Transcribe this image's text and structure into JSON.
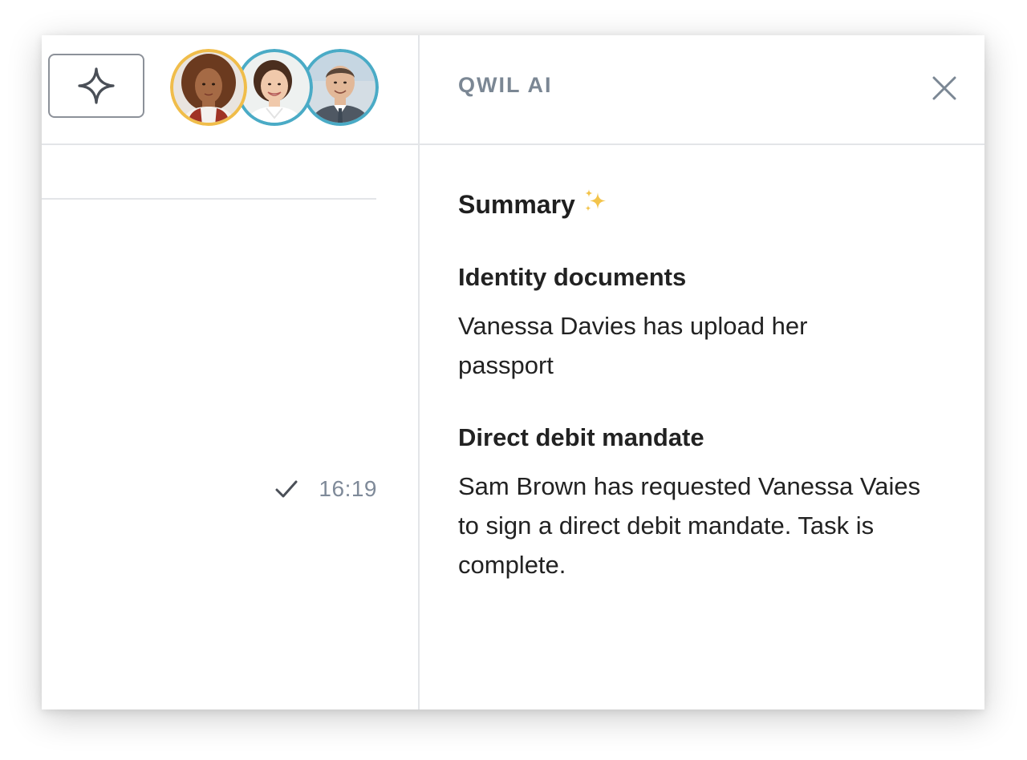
{
  "colors": {
    "border": "#e3e5e8",
    "muted_text": "#7b8794",
    "avatar_ring_yellow": "#f0bd4a",
    "avatar_ring_blue": "#4aabc6",
    "sparkle_yellow": "#f3c44b"
  },
  "left_pane": {
    "ai_button_icon": "sparkle-icon",
    "avatars": [
      {
        "name": "avatar-woman-curly-hair",
        "ring_color": "#f0bd4a"
      },
      {
        "name": "avatar-woman-smiling",
        "ring_color": "#4aabc6"
      },
      {
        "name": "avatar-man-suit",
        "ring_color": "#4aabc6"
      }
    ],
    "message": {
      "status_icon": "checkmark-icon",
      "time": "16:19"
    }
  },
  "right_pane": {
    "title": "QWIL AI",
    "close_icon": "close-icon",
    "summary": {
      "heading": "Summary",
      "heading_emoji": "✨",
      "sections": [
        {
          "title": "Identity documents",
          "body": "Vanessa Davies has upload her passport"
        },
        {
          "title": "Direct debit mandate",
          "body": "Sam Brown has requested Vanessa Vaies to sign a direct debit mandate. Task is complete."
        }
      ]
    }
  }
}
